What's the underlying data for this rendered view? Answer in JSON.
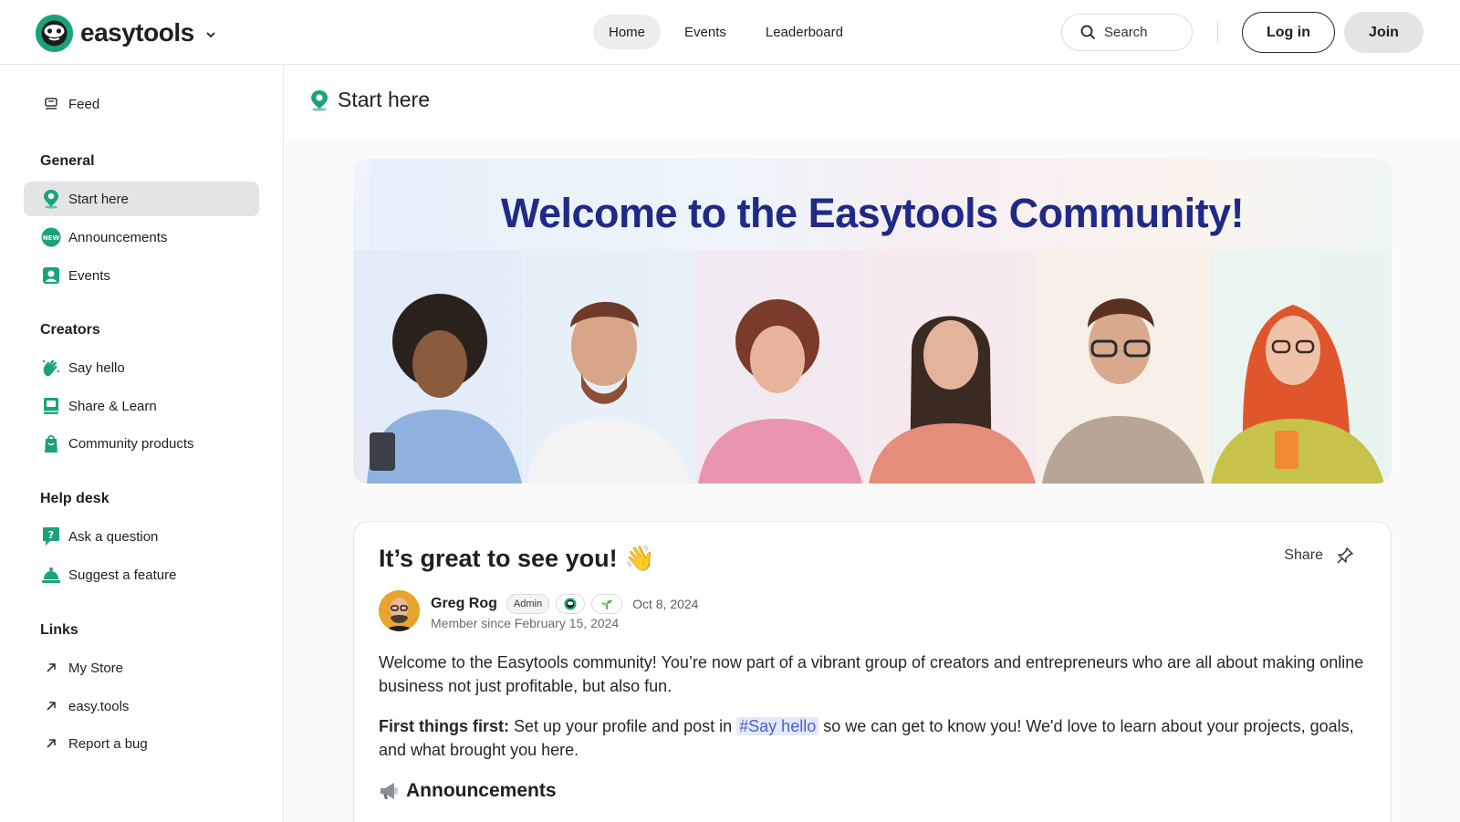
{
  "header": {
    "brand": "easytools",
    "nav": [
      {
        "label": "Home",
        "active": true
      },
      {
        "label": "Events",
        "active": false
      },
      {
        "label": "Leaderboard",
        "active": false
      }
    ],
    "search_label": "Search",
    "login_label": "Log in",
    "join_label": "Join"
  },
  "sidebar": {
    "feed": {
      "label": "Feed",
      "icon": "feed-icon"
    },
    "sections": [
      {
        "title": "General",
        "items": [
          {
            "label": "Start here",
            "icon": "location-pin-icon",
            "active": true
          },
          {
            "label": "Announcements",
            "icon": "new-badge-icon"
          },
          {
            "label": "Events",
            "icon": "calendar-person-icon"
          }
        ]
      },
      {
        "title": "Creators",
        "items": [
          {
            "label": "Say hello",
            "icon": "waving-hand-icon"
          },
          {
            "label": "Share & Learn",
            "icon": "book-icon"
          },
          {
            "label": "Community products",
            "icon": "product-icon"
          }
        ]
      },
      {
        "title": "Help desk",
        "items": [
          {
            "label": "Ask a question",
            "icon": "question-icon"
          },
          {
            "label": "Suggest a feature",
            "icon": "bell-icon"
          }
        ]
      },
      {
        "title": "Links",
        "items": [
          {
            "label": "My Store",
            "icon": "external-arrow-icon"
          },
          {
            "label": "easy.tools",
            "icon": "external-arrow-icon"
          },
          {
            "label": "Report a bug",
            "icon": "external-arrow-icon"
          }
        ]
      }
    ]
  },
  "main": {
    "page_title": "Start here",
    "banner_title": "Welcome to the Easytools Community!",
    "post": {
      "title": "It’s great to see you! 👋",
      "share_label": "Share",
      "author": "Greg Rog",
      "badge": "Admin",
      "date": "Oct 8, 2024",
      "member_since": "Member since February 15, 2024",
      "para1": "Welcome to the Easytools community! You’re now part of a vibrant group of creators and entrepreneurs who are all about making online business not just profitable, but also fun.",
      "para2_lead": "First things first:",
      "para2_a": " Set up your profile and post in ",
      "para2_tag": "#Say hello",
      "para2_b": " so we can get to know you! We'd love to learn about your projects, goals, and what brought you here.",
      "section_heading": "Announcements"
    }
  },
  "colors": {
    "accent": "#1aa37a",
    "banner_title": "#1f2a86",
    "hashtag": "#4a5fd0"
  }
}
